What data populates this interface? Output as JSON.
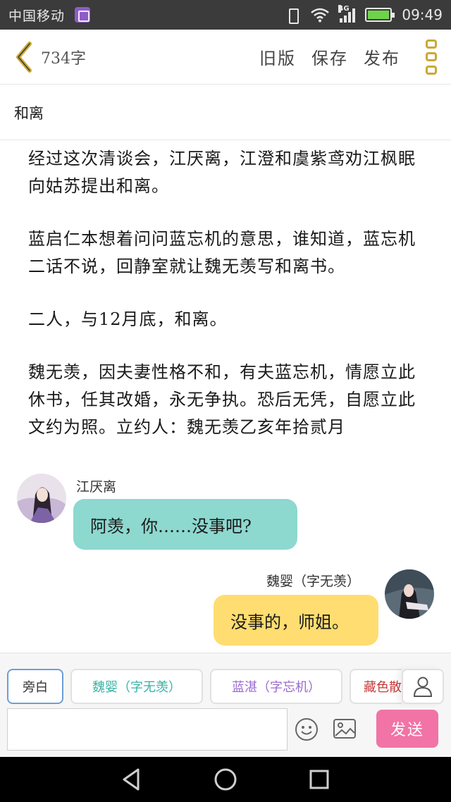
{
  "status_bar": {
    "carrier": "中国移动",
    "network": "4G",
    "time": "09:49",
    "battery_level": 1.0,
    "icons": [
      "gallery-icon",
      "vibrate-icon",
      "wifi-icon",
      "signal-icon",
      "battery-icon"
    ]
  },
  "header": {
    "word_count": "734字",
    "actions": [
      "旧版",
      "保存",
      "发布"
    ]
  },
  "doc": {
    "title": "和离",
    "paragraphs": [
      "经过这次清谈会，江厌离，江澄和虞紫鸢劝江枫眠向姑苏提出和离。",
      "蓝启仁本想着问问蓝忘机的意思，谁知道，蓝忘机二话不说，回静室就让魏无羡写和离书。",
      "二人，与12月底，和离。",
      "魏无羡，因夫妻性格不和，有夫蓝忘机，情愿立此休书，任其改婚，永无争执。恐后无凭，自愿立此文约为照。立约人：魏无羡乙亥年拾贰月"
    ]
  },
  "chat": [
    {
      "sender": "江厌离",
      "text": "阿羡，你……没事吧?",
      "side": "left",
      "bubble_color": "#8dd8cf"
    },
    {
      "sender": "魏婴（字无羡）",
      "text": "没事的，师姐。",
      "side": "right",
      "bubble_color": "#ffdd70"
    }
  ],
  "composer": {
    "chips": [
      "旁白",
      "魏婴（字无羡）",
      "蓝湛（字忘机）",
      "藏色散人"
    ],
    "input_value": "",
    "send_label": "发送"
  },
  "colors": {
    "accent": "#caa936",
    "send_button": "#f273a6",
    "chip_active_border": "#6b9ed9"
  }
}
